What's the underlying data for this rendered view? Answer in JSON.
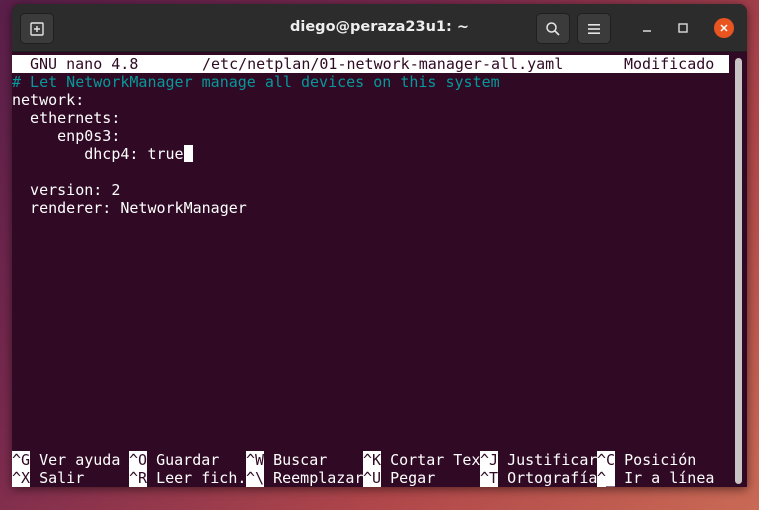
{
  "window": {
    "title": "diego@peraza23u1: ~"
  },
  "titlebar": {
    "new_tab_icon": "new-tab-icon",
    "search_icon": "search-icon",
    "menu_icon": "hamburger-menu-icon"
  },
  "nano": {
    "version": "GNU nano 4.8",
    "filename": "/etc/netplan/01-network-manager-all.yaml",
    "status": "Modificado"
  },
  "editor": {
    "lines": [
      "# Let NetworkManager manage all devices on this system",
      "network:",
      "  ethernets:",
      "     enp0s3:",
      "        dhcp4: true",
      "",
      "  version: 2",
      "  renderer: NetworkManager"
    ]
  },
  "shortcuts": {
    "row1": [
      {
        "key": "^G",
        "label": "Ver ayuda"
      },
      {
        "key": "^O",
        "label": "Guardar"
      },
      {
        "key": "^W",
        "label": "Buscar"
      },
      {
        "key": "^K",
        "label": "Cortar Tex"
      },
      {
        "key": "^J",
        "label": "Justificar"
      },
      {
        "key": "^C",
        "label": "Posición"
      }
    ],
    "row2": [
      {
        "key": "^X",
        "label": "Salir"
      },
      {
        "key": "^R",
        "label": "Leer fich."
      },
      {
        "key": "^\\",
        "label": "Reemplazar"
      },
      {
        "key": "^U",
        "label": "Pegar"
      },
      {
        "key": "^T",
        "label": "Ortografía"
      },
      {
        "key": "^_",
        "label": "Ir a línea"
      }
    ]
  },
  "colors": {
    "terminal_bg": "#300a24",
    "comment": "#06989a",
    "close_button": "#e95420"
  }
}
